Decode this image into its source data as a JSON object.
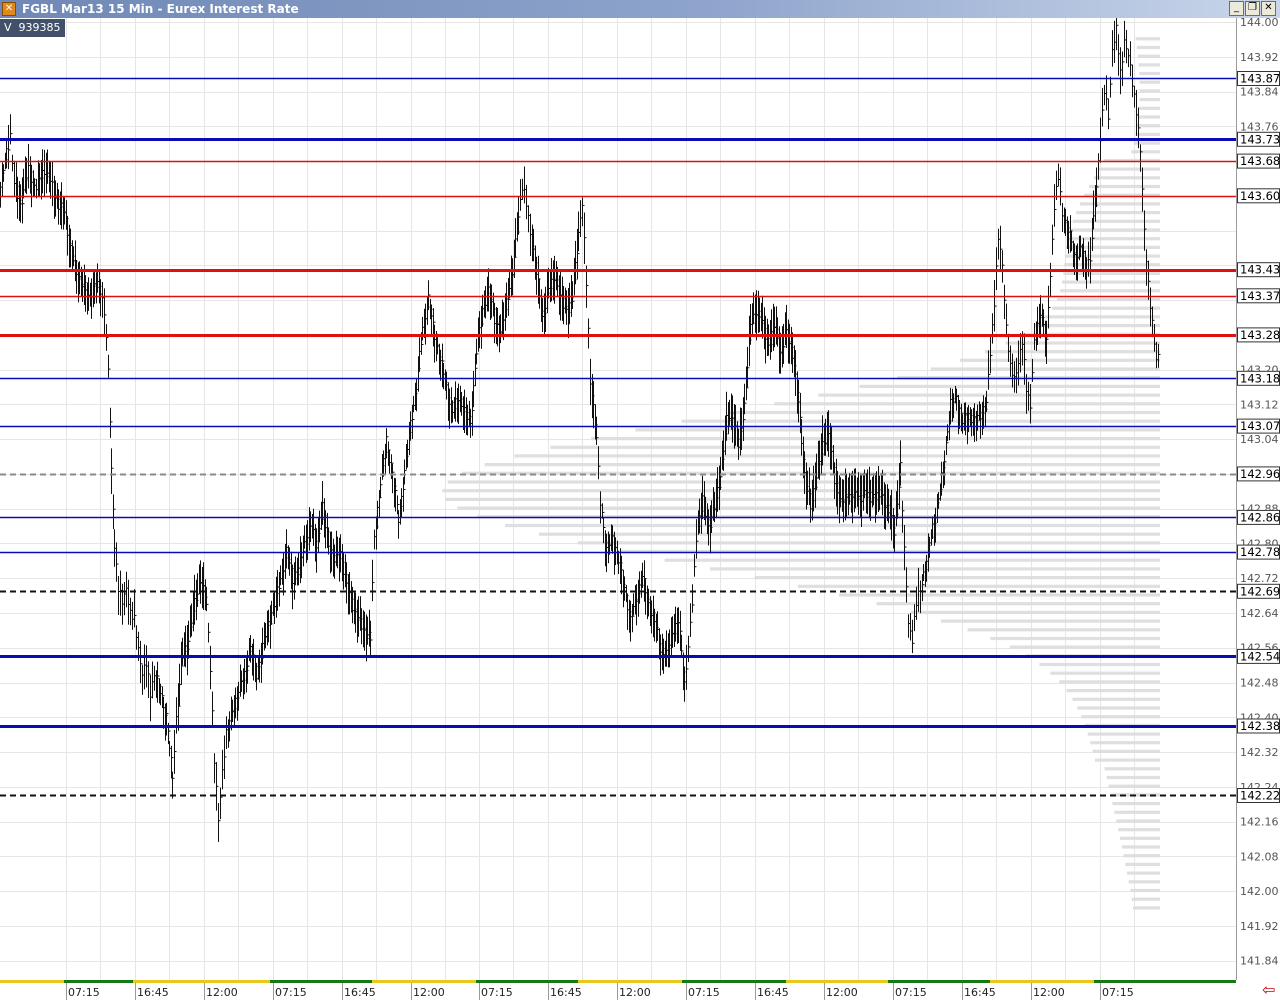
{
  "window": {
    "title": "FGBL Mar13 15 Min - Eurex Interest Rate",
    "buttons": [
      "_",
      "❐",
      "✕"
    ]
  },
  "volume": {
    "label": "V",
    "value": "939385"
  },
  "colors": {
    "blue": "#0a0ab8",
    "red": "#e01010",
    "grid": "#e6e6e6",
    "profile": "#dcdcdc",
    "session_green": "#157a15",
    "session_yellow": "#e8c81a"
  },
  "chart_data": {
    "type": "candlestick",
    "title": "FGBL Mar13 15 Min - Eurex Interest Rate",
    "ylim": [
      141.8,
      144.0
    ],
    "y_ticks": [
      "144.00",
      "143.92",
      "143.84",
      "143.76",
      "143.20",
      "143.12",
      "143.04",
      "142.88",
      "142.80",
      "142.72",
      "142.64",
      "142.56",
      "142.48",
      "142.40",
      "142.32",
      "142.24",
      "142.16",
      "142.08",
      "142.00",
      "141.92",
      "141.84"
    ],
    "x_ticks": [
      "07:15",
      "16:45",
      "12:00",
      "07:15",
      "16:45",
      "12:00",
      "07:15",
      "16:45",
      "12:00",
      "07:15",
      "16:45",
      "12:00",
      "07:15",
      "16:45",
      "12:00",
      "07:15"
    ],
    "levels": [
      {
        "price": "143.87",
        "color": "blue",
        "style": "solid",
        "weight": "thin"
      },
      {
        "price": "143.73",
        "color": "blue",
        "style": "solid",
        "weight": "thick"
      },
      {
        "price": "143.68",
        "color": "red",
        "style": "solid",
        "weight": "thin"
      },
      {
        "price": "143.60",
        "color": "red",
        "style": "solid",
        "weight": "thin"
      },
      {
        "price": "143.43",
        "color": "red",
        "style": "solid",
        "weight": "thick"
      },
      {
        "price": "143.37",
        "color": "red",
        "style": "solid",
        "weight": "thin"
      },
      {
        "price": "143.28",
        "color": "red",
        "style": "solid",
        "weight": "thick"
      },
      {
        "price": "143.18",
        "color": "blue",
        "style": "solid",
        "weight": "thin"
      },
      {
        "price": "143.07",
        "color": "blue",
        "style": "solid",
        "weight": "thin"
      },
      {
        "price": "142.96",
        "color": "gray",
        "style": "dashed",
        "weight": "thin"
      },
      {
        "price": "142.86",
        "color": "blue",
        "style": "solid",
        "weight": "thin"
      },
      {
        "price": "142.78",
        "color": "blue",
        "style": "solid",
        "weight": "thin"
      },
      {
        "price": "142.69",
        "color": "black",
        "style": "dashed",
        "weight": "thin"
      },
      {
        "price": "142.54",
        "color": "blue",
        "style": "solid",
        "weight": "thick"
      },
      {
        "price": "142.38",
        "color": "blue",
        "style": "solid",
        "weight": "thick"
      },
      {
        "price": "142.22",
        "color": "black",
        "style": "dashed",
        "weight": "thin"
      }
    ],
    "price_path": [
      [
        0,
        143.62
      ],
      [
        6,
        143.7
      ],
      [
        10,
        143.74
      ],
      [
        14,
        143.62
      ],
      [
        20,
        143.58
      ],
      [
        28,
        143.66
      ],
      [
        36,
        143.62
      ],
      [
        44,
        143.66
      ],
      [
        52,
        143.62
      ],
      [
        58,
        143.58
      ],
      [
        64,
        143.56
      ],
      [
        70,
        143.48
      ],
      [
        76,
        143.42
      ],
      [
        82,
        143.4
      ],
      [
        88,
        143.36
      ],
      [
        94,
        143.4
      ],
      [
        100,
        143.38
      ],
      [
        104,
        143.34
      ],
      [
        108,
        143.2
      ],
      [
        111,
        142.96
      ],
      [
        114,
        142.8
      ],
      [
        118,
        142.7
      ],
      [
        122,
        142.66
      ],
      [
        126,
        142.7
      ],
      [
        130,
        142.64
      ],
      [
        134,
        142.62
      ],
      [
        138,
        142.56
      ],
      [
        142,
        142.5
      ],
      [
        146,
        142.52
      ],
      [
        150,
        142.46
      ],
      [
        154,
        142.5
      ],
      [
        160,
        142.46
      ],
      [
        166,
        142.4
      ],
      [
        172,
        142.26
      ],
      [
        176,
        142.4
      ],
      [
        182,
        142.54
      ],
      [
        188,
        142.58
      ],
      [
        194,
        142.66
      ],
      [
        200,
        142.72
      ],
      [
        206,
        142.66
      ],
      [
        210,
        142.52
      ],
      [
        214,
        142.3
      ],
      [
        218,
        142.16
      ],
      [
        222,
        142.28
      ],
      [
        226,
        142.36
      ],
      [
        232,
        142.42
      ],
      [
        238,
        142.46
      ],
      [
        244,
        142.5
      ],
      [
        250,
        142.56
      ],
      [
        256,
        142.5
      ],
      [
        262,
        142.56
      ],
      [
        268,
        142.62
      ],
      [
        274,
        142.66
      ],
      [
        280,
        142.72
      ],
      [
        286,
        142.78
      ],
      [
        292,
        142.72
      ],
      [
        298,
        142.74
      ],
      [
        304,
        142.8
      ],
      [
        310,
        142.84
      ],
      [
        316,
        142.8
      ],
      [
        322,
        142.88
      ],
      [
        328,
        142.8
      ],
      [
        334,
        142.76
      ],
      [
        340,
        142.78
      ],
      [
        346,
        142.7
      ],
      [
        352,
        142.66
      ],
      [
        358,
        142.62
      ],
      [
        364,
        142.6
      ],
      [
        370,
        142.58
      ],
      [
        374,
        142.82
      ],
      [
        380,
        142.94
      ],
      [
        386,
        143.04
      ],
      [
        392,
        142.96
      ],
      [
        398,
        142.86
      ],
      [
        404,
        142.96
      ],
      [
        410,
        143.08
      ],
      [
        416,
        143.16
      ],
      [
        422,
        143.3
      ],
      [
        428,
        143.36
      ],
      [
        434,
        143.28
      ],
      [
        440,
        143.22
      ],
      [
        446,
        143.16
      ],
      [
        452,
        143.1
      ],
      [
        458,
        143.14
      ],
      [
        464,
        143.1
      ],
      [
        470,
        143.08
      ],
      [
        476,
        143.24
      ],
      [
        482,
        143.34
      ],
      [
        488,
        143.38
      ],
      [
        494,
        143.32
      ],
      [
        500,
        143.28
      ],
      [
        506,
        143.36
      ],
      [
        512,
        143.42
      ],
      [
        518,
        143.56
      ],
      [
        522,
        143.62
      ],
      [
        526,
        143.58
      ],
      [
        530,
        143.52
      ],
      [
        536,
        143.42
      ],
      [
        542,
        143.32
      ],
      [
        548,
        143.38
      ],
      [
        554,
        143.42
      ],
      [
        560,
        143.36
      ],
      [
        566,
        143.34
      ],
      [
        572,
        143.36
      ],
      [
        578,
        143.52
      ],
      [
        582,
        143.58
      ],
      [
        586,
        143.4
      ],
      [
        590,
        143.18
      ],
      [
        596,
        143.04
      ],
      [
        600,
        142.9
      ],
      [
        606,
        142.78
      ],
      [
        612,
        142.82
      ],
      [
        618,
        142.76
      ],
      [
        624,
        142.7
      ],
      [
        630,
        142.62
      ],
      [
        636,
        142.68
      ],
      [
        642,
        142.72
      ],
      [
        648,
        142.66
      ],
      [
        654,
        142.62
      ],
      [
        660,
        142.56
      ],
      [
        666,
        142.54
      ],
      [
        672,
        142.6
      ],
      [
        678,
        142.62
      ],
      [
        684,
        142.48
      ],
      [
        688,
        142.56
      ],
      [
        692,
        142.66
      ],
      [
        696,
        142.82
      ],
      [
        702,
        142.9
      ],
      [
        708,
        142.84
      ],
      [
        714,
        142.88
      ],
      [
        720,
        142.96
      ],
      [
        726,
        143.08
      ],
      [
        732,
        143.1
      ],
      [
        738,
        143.02
      ],
      [
        744,
        143.12
      ],
      [
        750,
        143.3
      ],
      [
        756,
        143.34
      ],
      [
        762,
        143.3
      ],
      [
        768,
        143.26
      ],
      [
        774,
        143.3
      ],
      [
        780,
        143.24
      ],
      [
        786,
        143.28
      ],
      [
        792,
        143.24
      ],
      [
        798,
        143.12
      ],
      [
        804,
        142.96
      ],
      [
        810,
        142.88
      ],
      [
        816,
        142.96
      ],
      [
        822,
        143.02
      ],
      [
        828,
        143.06
      ],
      [
        834,
        142.94
      ],
      [
        840,
        142.9
      ],
      [
        846,
        142.9
      ],
      [
        852,
        142.92
      ],
      [
        858,
        142.9
      ],
      [
        864,
        142.92
      ],
      [
        870,
        142.9
      ],
      [
        876,
        142.92
      ],
      [
        882,
        142.9
      ],
      [
        888,
        142.88
      ],
      [
        894,
        142.82
      ],
      [
        900,
        142.98
      ],
      [
        904,
        142.78
      ],
      [
        908,
        142.62
      ],
      [
        912,
        142.58
      ],
      [
        916,
        142.66
      ],
      [
        920,
        142.7
      ],
      [
        926,
        142.76
      ],
      [
        932,
        142.84
      ],
      [
        938,
        142.9
      ],
      [
        944,
        143.0
      ],
      [
        950,
        143.12
      ],
      [
        956,
        143.14
      ],
      [
        962,
        143.08
      ],
      [
        968,
        143.1
      ],
      [
        974,
        143.08
      ],
      [
        980,
        143.1
      ],
      [
        986,
        143.12
      ],
      [
        990,
        143.24
      ],
      [
        994,
        143.36
      ],
      [
        998,
        143.5
      ],
      [
        1002,
        143.44
      ],
      [
        1006,
        143.3
      ],
      [
        1010,
        143.2
      ],
      [
        1014,
        143.18
      ],
      [
        1018,
        143.22
      ],
      [
        1022,
        143.26
      ],
      [
        1026,
        143.16
      ],
      [
        1030,
        143.12
      ],
      [
        1034,
        143.26
      ],
      [
        1040,
        143.34
      ],
      [
        1046,
        143.26
      ],
      [
        1050,
        143.42
      ],
      [
        1054,
        143.58
      ],
      [
        1058,
        143.64
      ],
      [
        1062,
        143.56
      ],
      [
        1068,
        143.52
      ],
      [
        1074,
        143.46
      ],
      [
        1080,
        143.48
      ],
      [
        1086,
        143.44
      ],
      [
        1090,
        143.46
      ],
      [
        1096,
        143.62
      ],
      [
        1100,
        143.74
      ],
      [
        1104,
        143.84
      ],
      [
        1108,
        143.78
      ],
      [
        1112,
        143.94
      ],
      [
        1116,
        143.98
      ],
      [
        1120,
        143.88
      ],
      [
        1124,
        143.96
      ],
      [
        1128,
        143.92
      ],
      [
        1132,
        143.86
      ],
      [
        1136,
        143.8
      ],
      [
        1140,
        143.7
      ],
      [
        1144,
        143.52
      ],
      [
        1148,
        143.4
      ],
      [
        1152,
        143.3
      ],
      [
        1156,
        143.22
      ],
      [
        1160,
        143.26
      ]
    ]
  }
}
